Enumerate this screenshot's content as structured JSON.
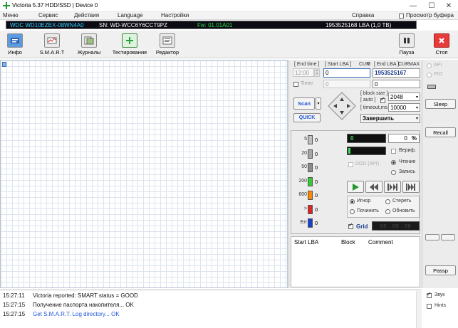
{
  "window": {
    "title": "Victoria 5.37 HDD/SSD | Device 0",
    "minimize": "—",
    "maximize": "☐",
    "close": "✕"
  },
  "menu": [
    "Меню",
    "Сервис",
    "Действия",
    "Language",
    "Настройки"
  ],
  "menu_right": {
    "help": "Справка",
    "buffer_view": "Просмотр буфера"
  },
  "info": {
    "model": "WDC WD10EZEX-08WN4A0",
    "serial": "SN: WD-WCC6Y6CCT9PZ",
    "firmware": "Fw: 01.01A01",
    "capacity": "1953525168 LBA (1,0 TB)"
  },
  "toolbar": {
    "info": "Инфо",
    "smart": "S.M.A.R.T",
    "logs": "Журналы",
    "test": "Тестирование",
    "editor": "Редактор",
    "pause": "Пауза",
    "stop": "Стоп"
  },
  "scan": {
    "end_time_label": "[ End time ]",
    "start_lba_label": "[ Start LBA ]",
    "start_lba_cur": "CUR",
    "start_lba_zero": "0",
    "end_lba_label": "[ End LBA ]",
    "end_lba_cur": "CUR",
    "end_lba_max": "MAX",
    "end_time_value": "12:00",
    "start_lba_value": "0",
    "end_lba_value": "1953525167",
    "timer_label": "Timer",
    "timer_value": "0",
    "end_value2": "0",
    "block_size_label": "[ block size ]",
    "auto_label": "[ auto ]",
    "block_size_value": "2048",
    "timeout_label": "[ timeout,ms ]",
    "timeout_value": "10000",
    "scan_button": "Scan",
    "quick_button": "QUICK",
    "finish_select": "Завершить"
  },
  "stats": {
    "counts": [
      {
        "label": "5",
        "count": "0",
        "color": "#bfbfbf"
      },
      {
        "label": "20",
        "count": "0",
        "color": "#a6a6a6"
      },
      {
        "label": "50",
        "count": "0",
        "color": "#8c8c8c"
      },
      {
        "label": "200",
        "count": "0",
        "color": "#33cc33"
      },
      {
        "label": "600",
        "count": "0",
        "color": "#ff8800"
      },
      {
        "label": ">",
        "count": "0",
        "color": "#dd2222"
      },
      {
        "label": "Err",
        "count": "0",
        "color": "#1a3fcc"
      }
    ],
    "speed_value": "0",
    "percent_value": "0",
    "percent_sign": "%",
    "ddd_label": "DDD (API)",
    "verify_label": "Вериф.",
    "read_label": "Чтение",
    "write_label": "Запись",
    "ignore_label": "Игнор",
    "erase_label": "Стереть",
    "remap_label": "Починить",
    "refresh_label": "Обновить",
    "grid_label": "Grid",
    "grid_time": "00 : 00 : 00"
  },
  "table": {
    "start_lba": "Start LBA",
    "block": "Block",
    "comment": "Comment"
  },
  "right": {
    "api": "API",
    "pio": "PIO",
    "sleep": "Sleep",
    "recall": "Recall",
    "passp": "Passp",
    "sound": "Звук",
    "hints": "Hints"
  },
  "log": [
    {
      "time": "15:27:11",
      "text": "Victoria reported: SMART status = GOOD",
      "color": "#111111"
    },
    {
      "time": "15:27:15",
      "text": "Получение паспорта накопителя... OK",
      "color": "#111111"
    },
    {
      "time": "15:27:15",
      "text": "Get S.M.A.R.T. Log directory... OK",
      "color": "#1f56d6"
    }
  ]
}
